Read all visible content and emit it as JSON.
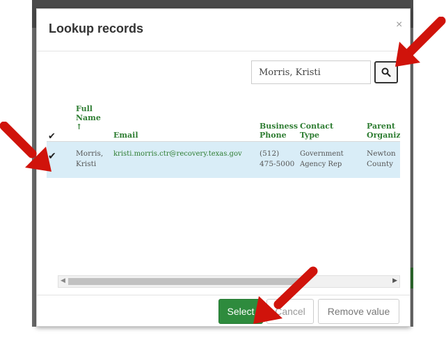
{
  "dialog": {
    "title": "Lookup records",
    "close_label": "×"
  },
  "search": {
    "value": "Morris, Kristi"
  },
  "table": {
    "check_header": "✔",
    "columns": [
      {
        "label": "Full Name ↑"
      },
      {
        "label": "Email"
      },
      {
        "label": "Business Phone"
      },
      {
        "label": "Contact Type"
      },
      {
        "label": "Parent Organiz"
      }
    ],
    "rows": [
      {
        "check": "✔",
        "full_name": "Morris, Kristi",
        "email": "kristi.morris.ctr@recovery.texas.gov",
        "business_phone": "(512) 475-5000",
        "contact_type": "Government Agency Rep",
        "parent_organization": "Newton County"
      }
    ]
  },
  "scrollbar": {
    "left_arrow": "◀",
    "right_arrow": "▶"
  },
  "buttons": {
    "select": "Select",
    "cancel": "Cancel",
    "remove": "Remove value"
  },
  "colors": {
    "accent_green": "#2e8b3d",
    "selected_row": "#d9edf7",
    "arrow_red": "#d0130b"
  }
}
